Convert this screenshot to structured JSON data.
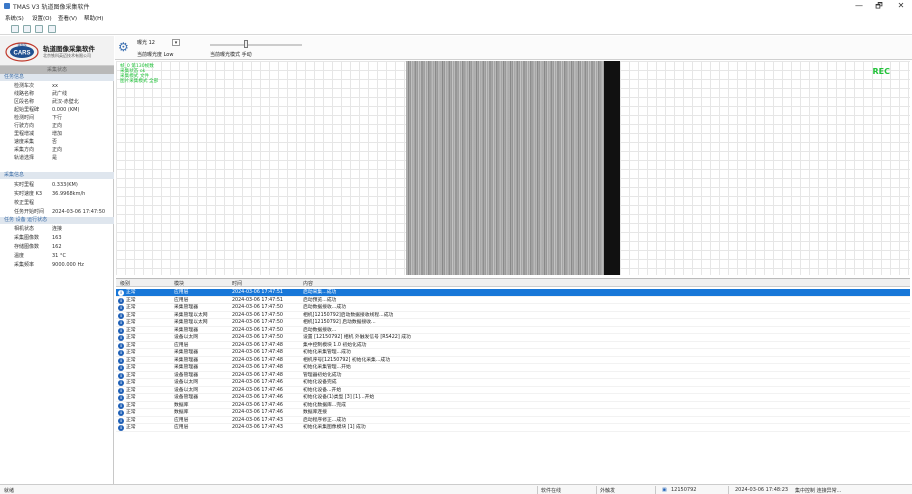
{
  "window": {
    "title": "TMAS V3 轨道图像采集软件",
    "minimize": "—",
    "maximize": "🗗",
    "close": "✕"
  },
  "menu": [
    "系统(S)",
    "设置(O)",
    "查看(V)",
    "帮助(H)"
  ],
  "logo": {
    "badge": "CARS",
    "badge_sub": "铁科院",
    "main": "轨道图像采集软件",
    "sub": "北京铁科英迈技术有限公司"
  },
  "left_panel": {
    "header": "采集状态",
    "sections": [
      {
        "title": "任务信息",
        "rows": [
          {
            "k": "检测车次",
            "v": "xx"
          },
          {
            "k": "线路名称",
            "v": "武广线"
          },
          {
            "k": "区段名称",
            "v": "武汉-赤壁北"
          },
          {
            "k": "起始里程碑",
            "v": "0.000 (KM)"
          },
          {
            "k": "检测时间",
            "v": "下行"
          },
          {
            "k": "行驶方向",
            "v": "正向"
          },
          {
            "k": "里程增减",
            "v": "增加"
          },
          {
            "k": "速度采集",
            "v": "否"
          },
          {
            "k": "采集方向",
            "v": "正向"
          },
          {
            "k": "轨道选择",
            "v": "是"
          }
        ]
      },
      {
        "title": "采集信息",
        "rows": [
          {
            "k": "实时里程",
            "v": "0.333(KM)"
          },
          {
            "k": "实时速度 K3",
            "v": "36.9968km/h"
          },
          {
            "k": "校正里程",
            "v": ""
          },
          {
            "k": "任务开始时间",
            "v": "2024-03-06 17:47:50"
          }
        ]
      },
      {
        "title": "任务 设备 运行状态",
        "rows": [
          {
            "k": "相机状态",
            "v": "连接"
          },
          {
            "k": "采集图像数",
            "v": "163"
          },
          {
            "k": "存储图像数",
            "v": "162"
          },
          {
            "k": "温度",
            "v": "31 °C"
          },
          {
            "k": "采集频率",
            "v": "9000.000 Hz"
          }
        ]
      }
    ]
  },
  "controls": {
    "exposure_label": "曝光 12",
    "dropdown_arrow": "▾",
    "exposure_mode": "当前曝光度 Low",
    "gain_mode": "当前曝光模式 手动"
  },
  "view": {
    "overlay": [
      "帧_0 第130帧数",
      "采集状态 ok",
      "采集模式 文件",
      "图片采集模式 全部"
    ],
    "rec": "REC"
  },
  "log": {
    "columns": [
      "级别",
      "模块",
      "时间",
      "内容"
    ],
    "rows": [
      {
        "level": "正常",
        "module": "应用层",
        "time": "2024-03-06 17:47:51",
        "content": "启动采集...成功"
      },
      {
        "level": "正常",
        "module": "应用层",
        "time": "2024-03-06 17:47:51",
        "content": "启动预览...成功"
      },
      {
        "level": "正常",
        "module": "采集管理器",
        "time": "2024-03-06 17:47:50",
        "content": "启动数据接收...成功"
      },
      {
        "level": "正常",
        "module": "采集管理以太网",
        "time": "2024-03-06 17:47:50",
        "content": "相机[12150792]启动数据接收线程...成功"
      },
      {
        "level": "正常",
        "module": "采集管理以太网",
        "time": "2024-03-06 17:47:50",
        "content": "相机[12150792] 启动数据接收..."
      },
      {
        "level": "正常",
        "module": "采集管理器",
        "time": "2024-03-06 17:47:50",
        "content": "启动数据接收..."
      },
      {
        "level": "正常",
        "module": "设备以太网",
        "time": "2024-03-06 17:47:50",
        "content": "设置 [12150792] 相机 外触发信号 [RS422] 成功"
      },
      {
        "level": "正常",
        "module": "应用层",
        "time": "2024-03-06 17:47:48",
        "content": "集中控制模块 1.0 初始化成功"
      },
      {
        "level": "正常",
        "module": "采集管理器",
        "time": "2024-03-06 17:47:48",
        "content": "初始化采集管理...成功"
      },
      {
        "level": "正常",
        "module": "采集管理器",
        "time": "2024-03-06 17:47:48",
        "content": "相机序号[12150792] 初始化采集...成功"
      },
      {
        "level": "正常",
        "module": "采集管理器",
        "time": "2024-03-06 17:47:48",
        "content": "初始化采集管理...开始"
      },
      {
        "level": "正常",
        "module": "设备管理器",
        "time": "2024-03-06 17:47:48",
        "content": "管理器初始化成功"
      },
      {
        "level": "正常",
        "module": "设备以太网",
        "time": "2024-03-06 17:47:46",
        "content": "初始化设备完成"
      },
      {
        "level": "正常",
        "module": "设备以太网",
        "time": "2024-03-06 17:47:46",
        "content": "初始化设备...开始"
      },
      {
        "level": "正常",
        "module": "设备管理器",
        "time": "2024-03-06 17:47:46",
        "content": "初始化设备(1)类型 [3] [1]...开始"
      },
      {
        "level": "正常",
        "module": "数据库",
        "time": "2024-03-06 17:47:46",
        "content": "初始化数据库...完成"
      },
      {
        "level": "正常",
        "module": "数据库",
        "time": "2024-03-06 17:47:46",
        "content": "数据库连接"
      },
      {
        "level": "正常",
        "module": "应用层",
        "time": "2024-03-06 17:47:43",
        "content": "启动程序修正...成功"
      },
      {
        "level": "正常",
        "module": "应用层",
        "time": "2024-03-06 17:47:43",
        "content": "初始化采集图像模块 [1] 成功"
      }
    ]
  },
  "statusbar": {
    "left": "就绪",
    "camera_state": "软件在线",
    "ext": "外触发",
    "camera_id": "12150792",
    "datetime": "2024-03-06 17:48:23",
    "control": "集中控制 连接异常..."
  }
}
